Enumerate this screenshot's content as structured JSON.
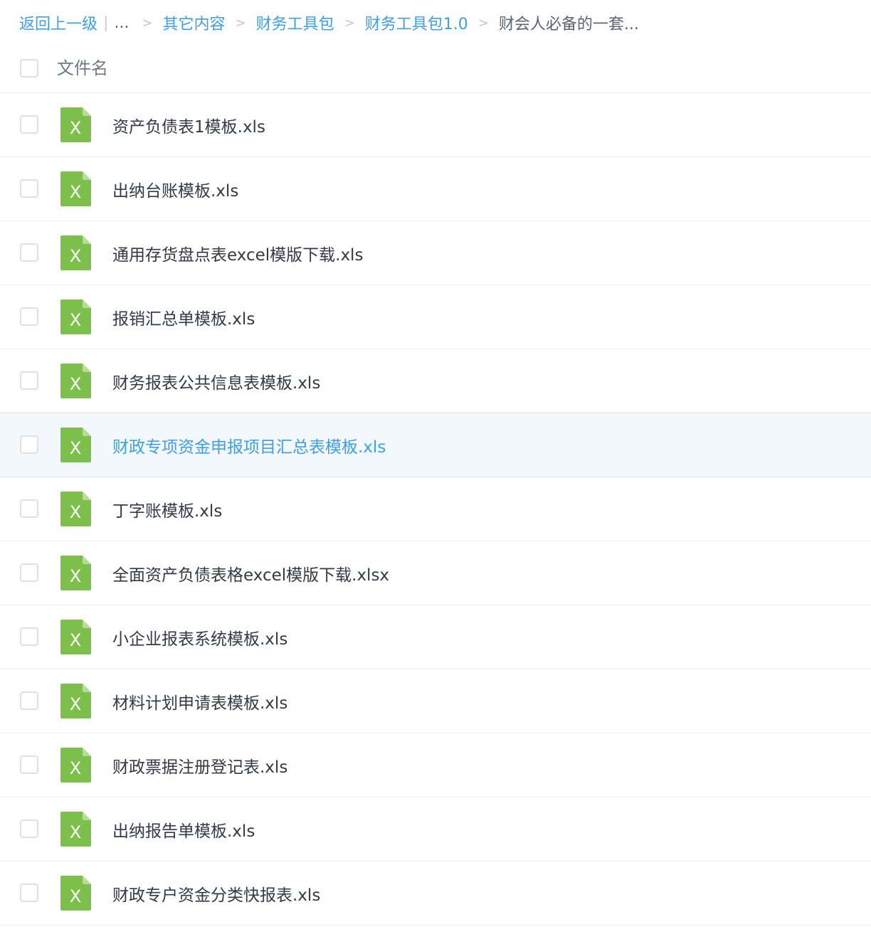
{
  "breadcrumb": {
    "back": "返回上一级",
    "bar": "|",
    "ellipsis": "...",
    "separator": ">",
    "items": [
      "其它内容",
      "财务工具包",
      "财务工具包1.0"
    ],
    "current": "财会人必备的一套..."
  },
  "header": {
    "name_label": "文件名"
  },
  "icon": {
    "type": "excel-icon",
    "glyph": "X",
    "color": "#7cc04b"
  },
  "accent_color": "#3d9fe4",
  "files": [
    {
      "name": "资产负债表1模板.xls"
    },
    {
      "name": "出纳台账模板.xls"
    },
    {
      "name": "通用存货盘点表excel模版下载.xls"
    },
    {
      "name": "报销汇总单模板.xls"
    },
    {
      "name": "财务报表公共信息表模板.xls"
    },
    {
      "name": "财政专项资金申报项目汇总表模板.xls",
      "selected": true
    },
    {
      "name": "丁字账模板.xls"
    },
    {
      "name": "全面资产负债表格excel模版下载.xlsx"
    },
    {
      "name": "小企业报表系统模板.xls"
    },
    {
      "name": "材料计划申请表模板.xls"
    },
    {
      "name": "财政票据注册登记表.xls"
    },
    {
      "name": "出纳报告单模板.xls"
    },
    {
      "name": "财政专户资金分类快报表.xls"
    }
  ]
}
